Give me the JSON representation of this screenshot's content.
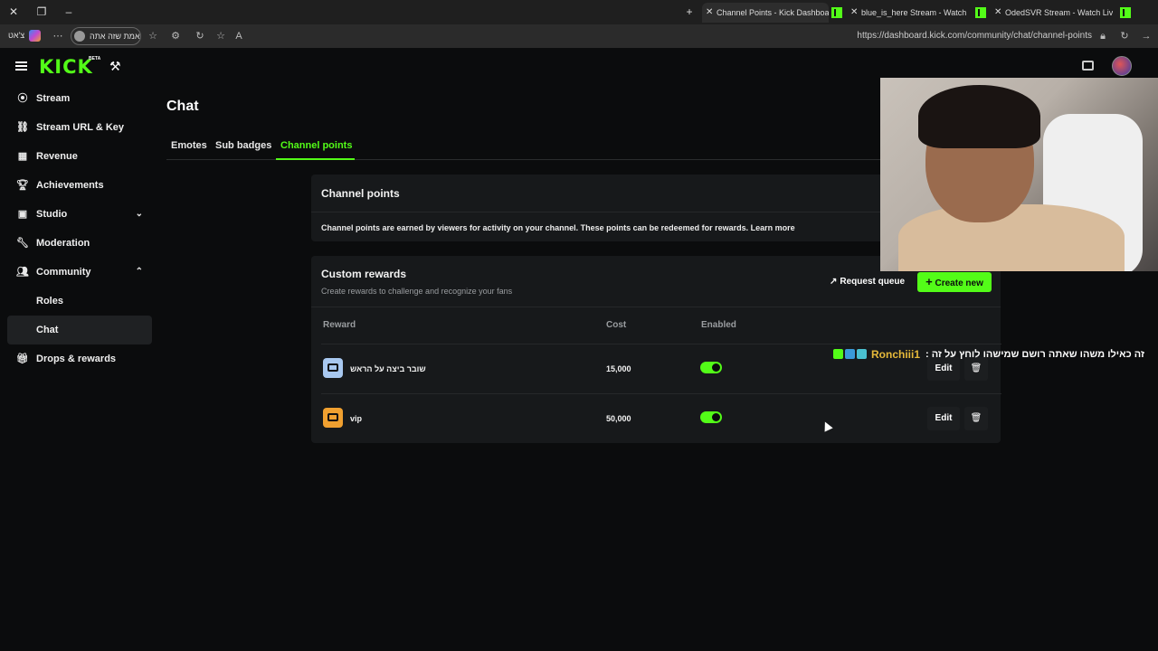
{
  "browser": {
    "tabs": [
      {
        "label": "Channel Points - Kick Dashboard",
        "active": true
      },
      {
        "label": "blue_is_here Stream - Watch Live o",
        "active": false
      },
      {
        "label": "OdedSVR Stream - Watch Live on",
        "active": false
      }
    ],
    "profile_label": "אמת שזה אתה",
    "left_label": "צ'אט",
    "url": "https://dashboard.kick.com/community/chat/channel-points"
  },
  "app": {
    "logo": "KICK",
    "beta": "BETA"
  },
  "sidebar": {
    "items": [
      {
        "label": "Stream",
        "icon": "broadcast-icon"
      },
      {
        "label": "Stream URL & Key",
        "icon": "link-icon"
      },
      {
        "label": "Revenue",
        "icon": "revenue-icon"
      },
      {
        "label": "Achievements",
        "icon": "trophy-icon"
      },
      {
        "label": "Studio",
        "icon": "studio-icon"
      },
      {
        "label": "Moderation",
        "icon": "wrench-icon"
      },
      {
        "label": "Community",
        "icon": "community-icon"
      },
      {
        "label": "Roles",
        "icon": ""
      },
      {
        "label": "Chat",
        "icon": ""
      },
      {
        "label": "Drops & rewards",
        "icon": "gift-icon"
      }
    ]
  },
  "page": {
    "title": "Chat",
    "tabs": [
      "Emotes",
      "Sub badges",
      "Channel points"
    ]
  },
  "channel_points": {
    "title": "Channel points",
    "description": "Channel points are earned by viewers for activity on your channel. These points can be redeemed for rewards. Learn more"
  },
  "custom_rewards": {
    "title": "Custom rewards",
    "subtitle": "Create rewards to challenge and recognize your fans",
    "request_queue": "Request queue",
    "create_new": "Create new",
    "headers": {
      "reward": "Reward",
      "cost": "Cost",
      "enabled": "Enabled"
    },
    "rows": [
      {
        "name": "שובר ביצה על הראש",
        "cost": "15,000",
        "enabled": true,
        "icon_color": "#a8c8f0",
        "edit": "Edit"
      },
      {
        "name": "vip",
        "cost": "50,000",
        "enabled": true,
        "icon_color": "#f0a030",
        "edit": "Edit"
      }
    ]
  },
  "chat_overlay": {
    "username": "Ronchiii1",
    "message": "זה כאילו משהו שאתה רושם שמישהו לוחץ על זה :"
  }
}
